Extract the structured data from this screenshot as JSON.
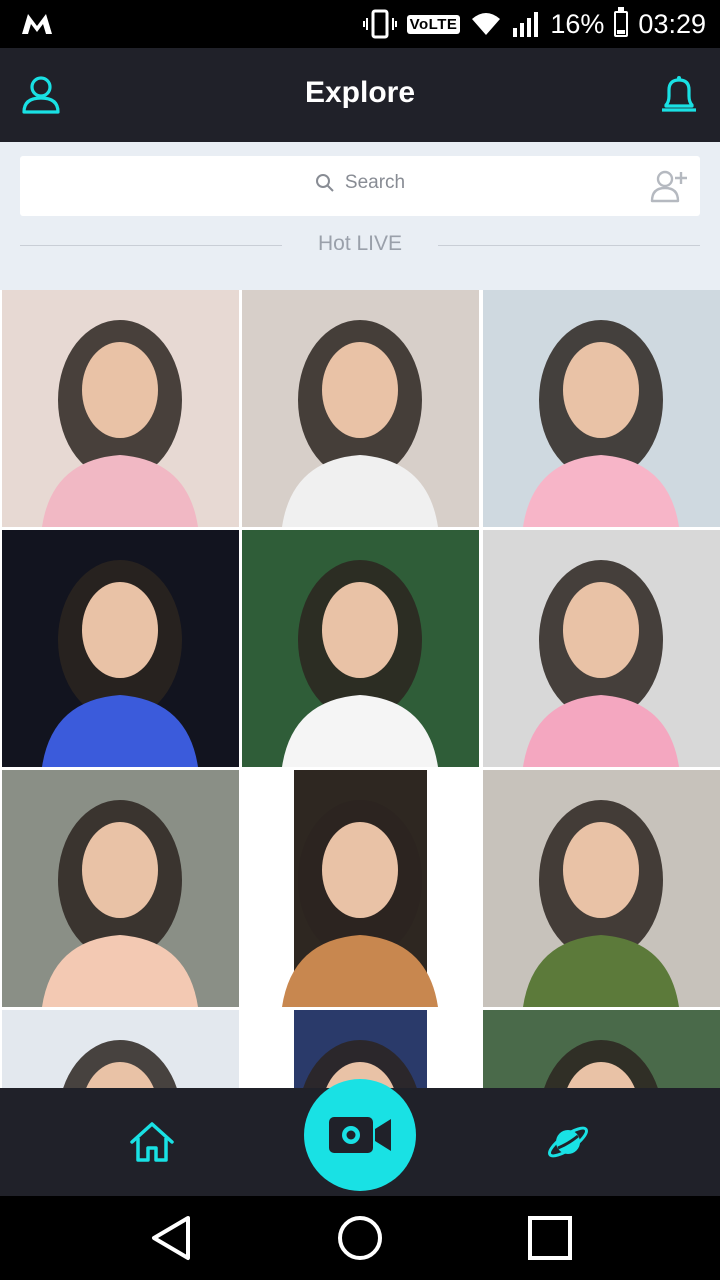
{
  "status_bar": {
    "network": "VoLTE",
    "battery_percent": "16%",
    "battery_level": 0.16,
    "time": "03:29"
  },
  "header": {
    "title": "Explore",
    "left_icon": "profile-icon",
    "right_icon": "bell-icon"
  },
  "search": {
    "placeholder": "Search",
    "add_icon": "add-user-icon"
  },
  "section": {
    "title": "Hot LIVE"
  },
  "streams": [
    {
      "thumb": "woman-pink-dress",
      "bg": "#e7d9d3",
      "accent": "#f1b8c4"
    },
    {
      "thumb": "girl-white-cap",
      "bg": "#d7cfc9",
      "accent": "#f0f0f0"
    },
    {
      "thumb": "girl-flower-crown",
      "bg": "#cfd9e0",
      "accent": "#f7b5c8"
    },
    {
      "thumb": "dj-mixer",
      "bg": "#12141f",
      "accent": "#3b5bdb"
    },
    {
      "thumb": "woman-palm-leaves",
      "bg": "#2f5d38",
      "accent": "#f5f5f5"
    },
    {
      "thumb": "man-flower-crown",
      "bg": "#d8d8d8",
      "accent": "#f4a7c0"
    },
    {
      "thumb": "hand-phone",
      "bg": "#8a8f86",
      "accent": "#f3c9b3"
    },
    {
      "thumb": "girl-dog-filter",
      "bg": "#2e2721",
      "accent": "#c8874f"
    },
    {
      "thumb": "girl-palace",
      "bg": "#c7c2bb",
      "accent": "#5c7a3a"
    },
    {
      "thumb": "woman-ny-cap",
      "bg": "#e3e8ee",
      "accent": "#222831"
    },
    {
      "thumb": "girl-closeup",
      "bg": "#2a3a6a",
      "accent": "#1b1b1b"
    },
    {
      "thumb": "man-outdoor",
      "bg": "#4a6a4a",
      "accent": "#e0d6c8"
    }
  ],
  "bottom_nav": {
    "home_icon": "home-icon",
    "live_icon": "video-camera-icon",
    "explore_icon": "planet-icon",
    "accent": "#19e1e4"
  }
}
